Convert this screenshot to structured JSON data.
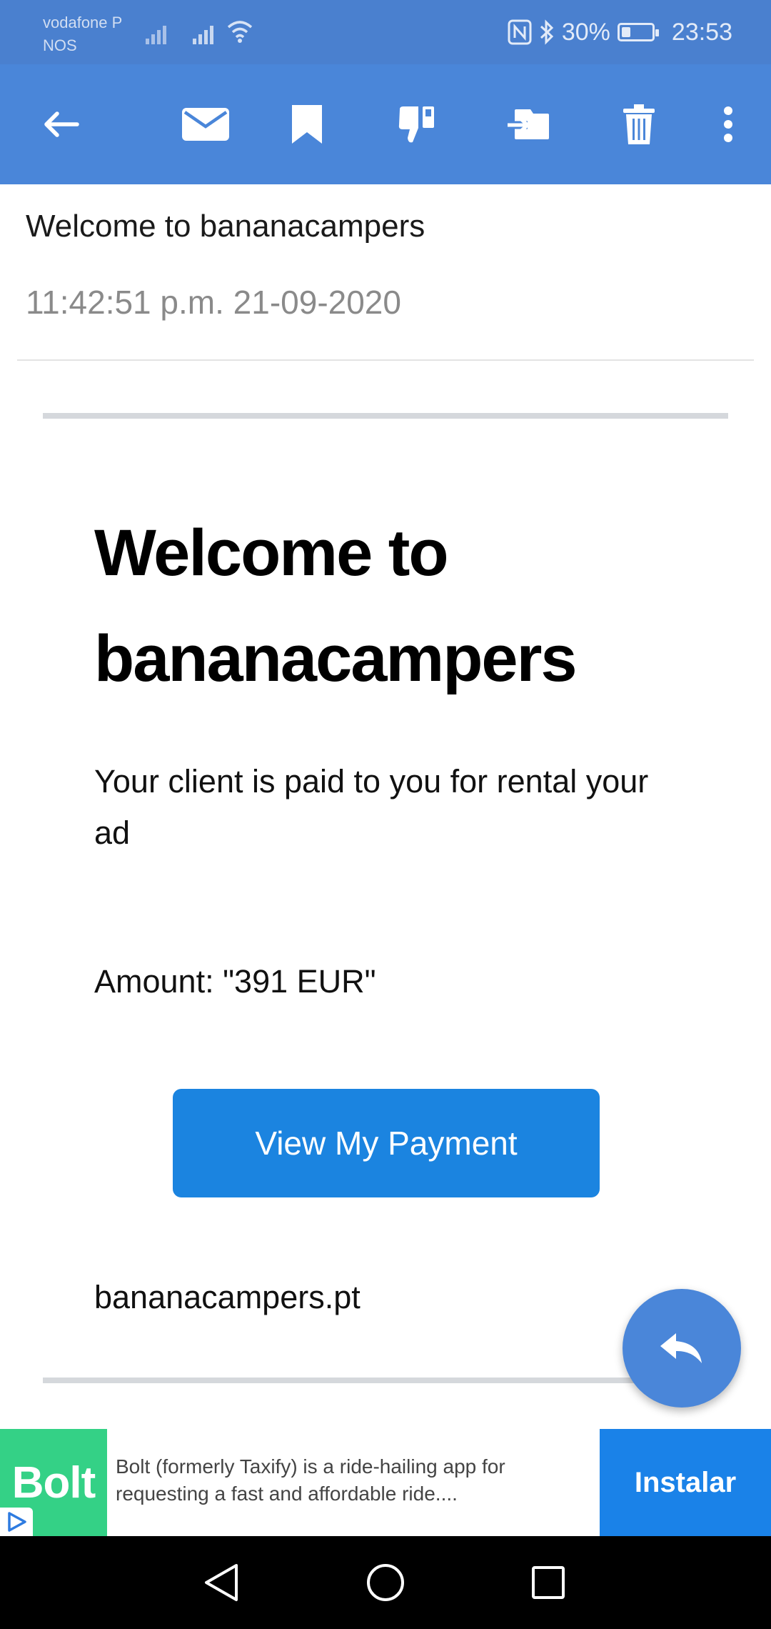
{
  "status_bar": {
    "carrier_1": "vodafone P",
    "carrier_2": "NOS",
    "battery_percent": "30%",
    "battery_level": 0.3,
    "time": "23:53"
  },
  "toolbar": {
    "icons": [
      "back-arrow-icon",
      "mail-icon",
      "bookmark-icon",
      "thumbs-down-icon",
      "move-icon",
      "trash-icon",
      "more-vert-icon"
    ]
  },
  "message": {
    "subject": "Welcome to bananacampers",
    "timestamp": "11:42:51 p.m. 21-09-2020"
  },
  "email_body": {
    "title": "Welcome to bananacampers",
    "text": "Your client is paid to you for rental your ad",
    "amount": "Amount: \"391 EUR\"",
    "button_label": "View My Payment",
    "site": "bananacampers.pt"
  },
  "ad": {
    "logo": "Bolt",
    "text": "Bolt (formerly Taxify) is a ride-hailing app for requesting a fast and affordable ride....",
    "install_label": "Instalar"
  },
  "colors": {
    "status_bar": "#4a80cf",
    "toolbar": "#4a86d9",
    "primary_button": "#1b84e0",
    "ad_logo": "#34d186",
    "ad_install": "#1a82e8"
  }
}
